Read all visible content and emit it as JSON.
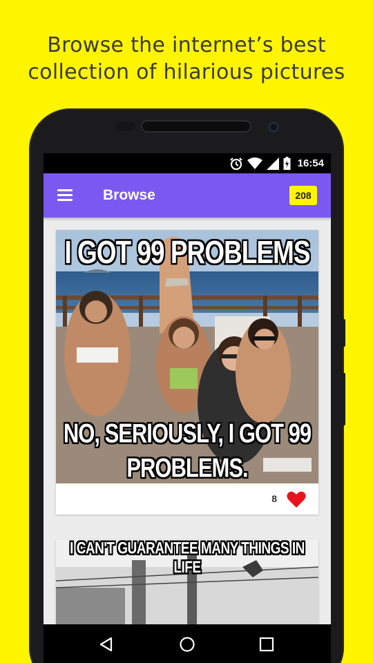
{
  "promo": {
    "line1": "Browse the internet’s best",
    "line2": "collection of hilarious pictures"
  },
  "status_bar": {
    "time": "16:54",
    "icons": [
      "alarm-icon",
      "wifi-icon",
      "signal-icon",
      "battery-icon"
    ]
  },
  "app_bar": {
    "menu_icon": "hamburger-menu-icon",
    "title": "Browse",
    "badge": "208"
  },
  "colors": {
    "background": "#FFF500",
    "app_bar": "#7B59F1",
    "badge": "#FFF500",
    "heart": "#E8141C"
  },
  "feed": {
    "posts": [
      {
        "caption_top": "I GOT 99 PROBLEMS",
        "caption_bottom_1": "NO, SERIOUSLY, I GOT 99",
        "caption_bottom_2": "PROBLEMS.",
        "likes": "8",
        "like_icon": "heart-icon"
      },
      {
        "caption_top": "I CAN'T GUARANTEE MANY THINGS IN LIFE"
      }
    ]
  },
  "nav_bar": {
    "buttons": [
      "back-icon",
      "home-icon",
      "recents-icon"
    ]
  }
}
